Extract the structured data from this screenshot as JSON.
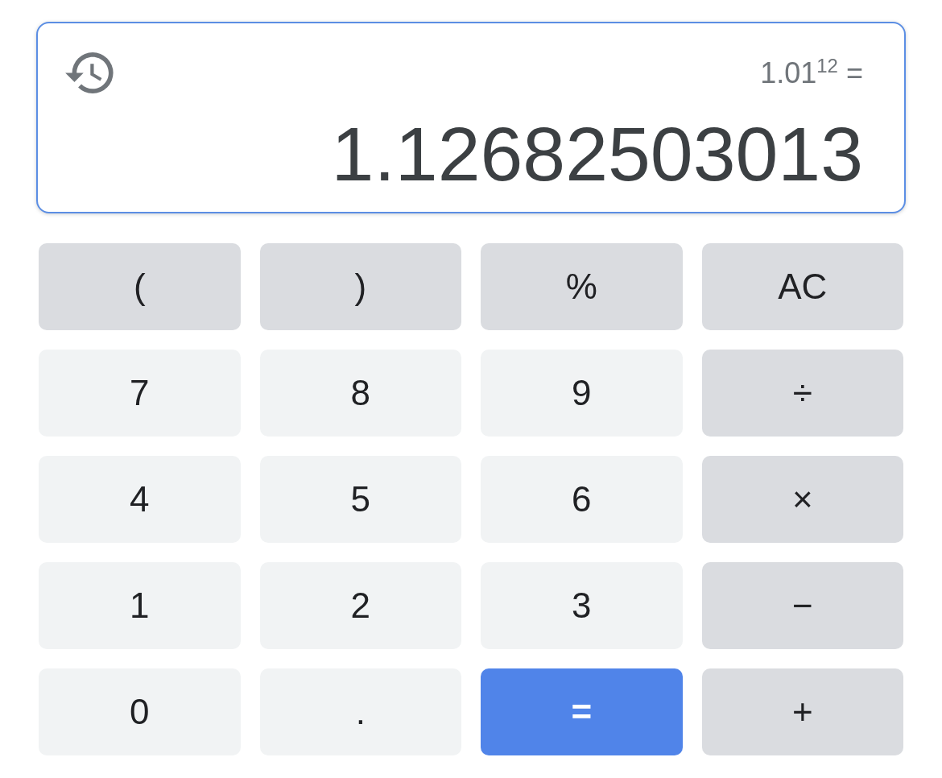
{
  "display": {
    "expression": "1.01$^{12}$ =",
    "result": "1.12682503013"
  },
  "keys": [
    {
      "label": "(",
      "kind": "function"
    },
    {
      "label": ")",
      "kind": "function"
    },
    {
      "label": "%",
      "kind": "function"
    },
    {
      "label": "AC",
      "kind": "function"
    },
    {
      "label": "7",
      "kind": "digit"
    },
    {
      "label": "8",
      "kind": "digit"
    },
    {
      "label": "9",
      "kind": "digit"
    },
    {
      "label": "÷",
      "kind": "operator"
    },
    {
      "label": "4",
      "kind": "digit"
    },
    {
      "label": "5",
      "kind": "digit"
    },
    {
      "label": "6",
      "kind": "digit"
    },
    {
      "label": "×",
      "kind": "operator"
    },
    {
      "label": "1",
      "kind": "digit"
    },
    {
      "label": "2",
      "kind": "digit"
    },
    {
      "label": "3",
      "kind": "digit"
    },
    {
      "label": "−",
      "kind": "operator"
    },
    {
      "label": "0",
      "kind": "digit"
    },
    {
      "label": ".",
      "kind": "digit"
    },
    {
      "label": "=",
      "kind": "equals"
    },
    {
      "label": "+",
      "kind": "operator"
    }
  ]
}
